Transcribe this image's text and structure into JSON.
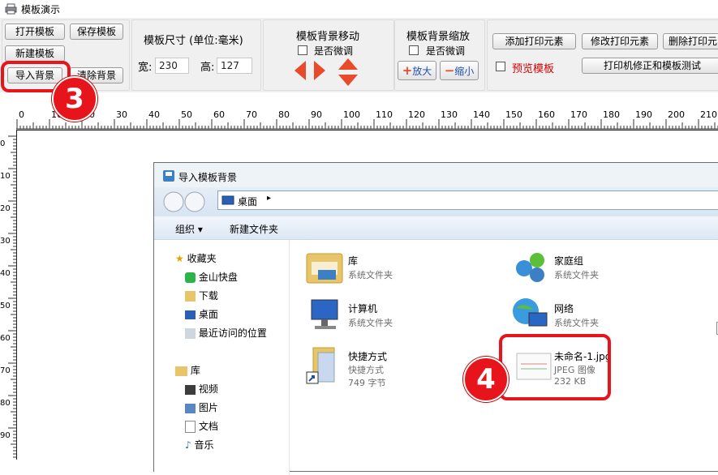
{
  "window": {
    "title": "模板演示"
  },
  "toolbar": {
    "open_template": "打开模板",
    "save_template": "保存模板",
    "new_template": "新建模板",
    "import_background": "导入背景",
    "clear_background": "清除背景",
    "size_title": "模板尺寸 (单位:毫米)",
    "width_label": "宽:",
    "width_value": "230",
    "height_label": "高:",
    "height_value": "127",
    "bg_move_title": "模板背景移动",
    "fine_tune_label": "是否微调",
    "bg_zoom_title": "模板背景缩放",
    "zoom_in": "放大",
    "zoom_out": "缩小",
    "add_print_element": "添加打印元素",
    "modify_print_element": "修改打印元素",
    "delete_print_element": "删除打印元",
    "preview_template": "预览模板",
    "printer_fix": "打印机修正和模板测试"
  },
  "ruler": {
    "labels": [
      "0",
      "10",
      "20",
      "30",
      "40",
      "50",
      "60",
      "70",
      "80",
      "90",
      "100",
      "110",
      "120",
      "130",
      "140",
      "150",
      "160",
      "170",
      "180",
      "190",
      "200",
      "210"
    ]
  },
  "vruler": {
    "labels": [
      "0",
      "10",
      "20",
      "30",
      "40",
      "50",
      "60",
      "70",
      "80",
      "90"
    ]
  },
  "dialog": {
    "title": "导入模板背景",
    "address": "桌面",
    "organize": "组织 ▾",
    "new_folder": "新建文件夹",
    "nav": {
      "favorites": "收藏夹",
      "jinshan": "金山快盘",
      "downloads": "下载",
      "desktop": "桌面",
      "recent": "最近访问的位置",
      "library": "库",
      "videos": "视频",
      "pictures": "图片",
      "documents": "文档",
      "music": "音乐"
    },
    "files": [
      {
        "name": "库",
        "sub": "系统文件夹"
      },
      {
        "name": "家庭组",
        "sub": "系统文件夹"
      },
      {
        "name": "计算机",
        "sub": "系统文件夹"
      },
      {
        "name": "网络",
        "sub": "系统文件夹"
      },
      {
        "name": "快捷方式",
        "sub": "快捷方式",
        "size": "749 字节"
      },
      {
        "name": "未命名-1.jpg",
        "sub": "JPEG 图像",
        "size": "232 KB"
      }
    ]
  },
  "callouts": {
    "step3": "3",
    "step4": "4"
  },
  "colors": {
    "accent_red": "#e8141c",
    "preview_red": "#d40000"
  }
}
